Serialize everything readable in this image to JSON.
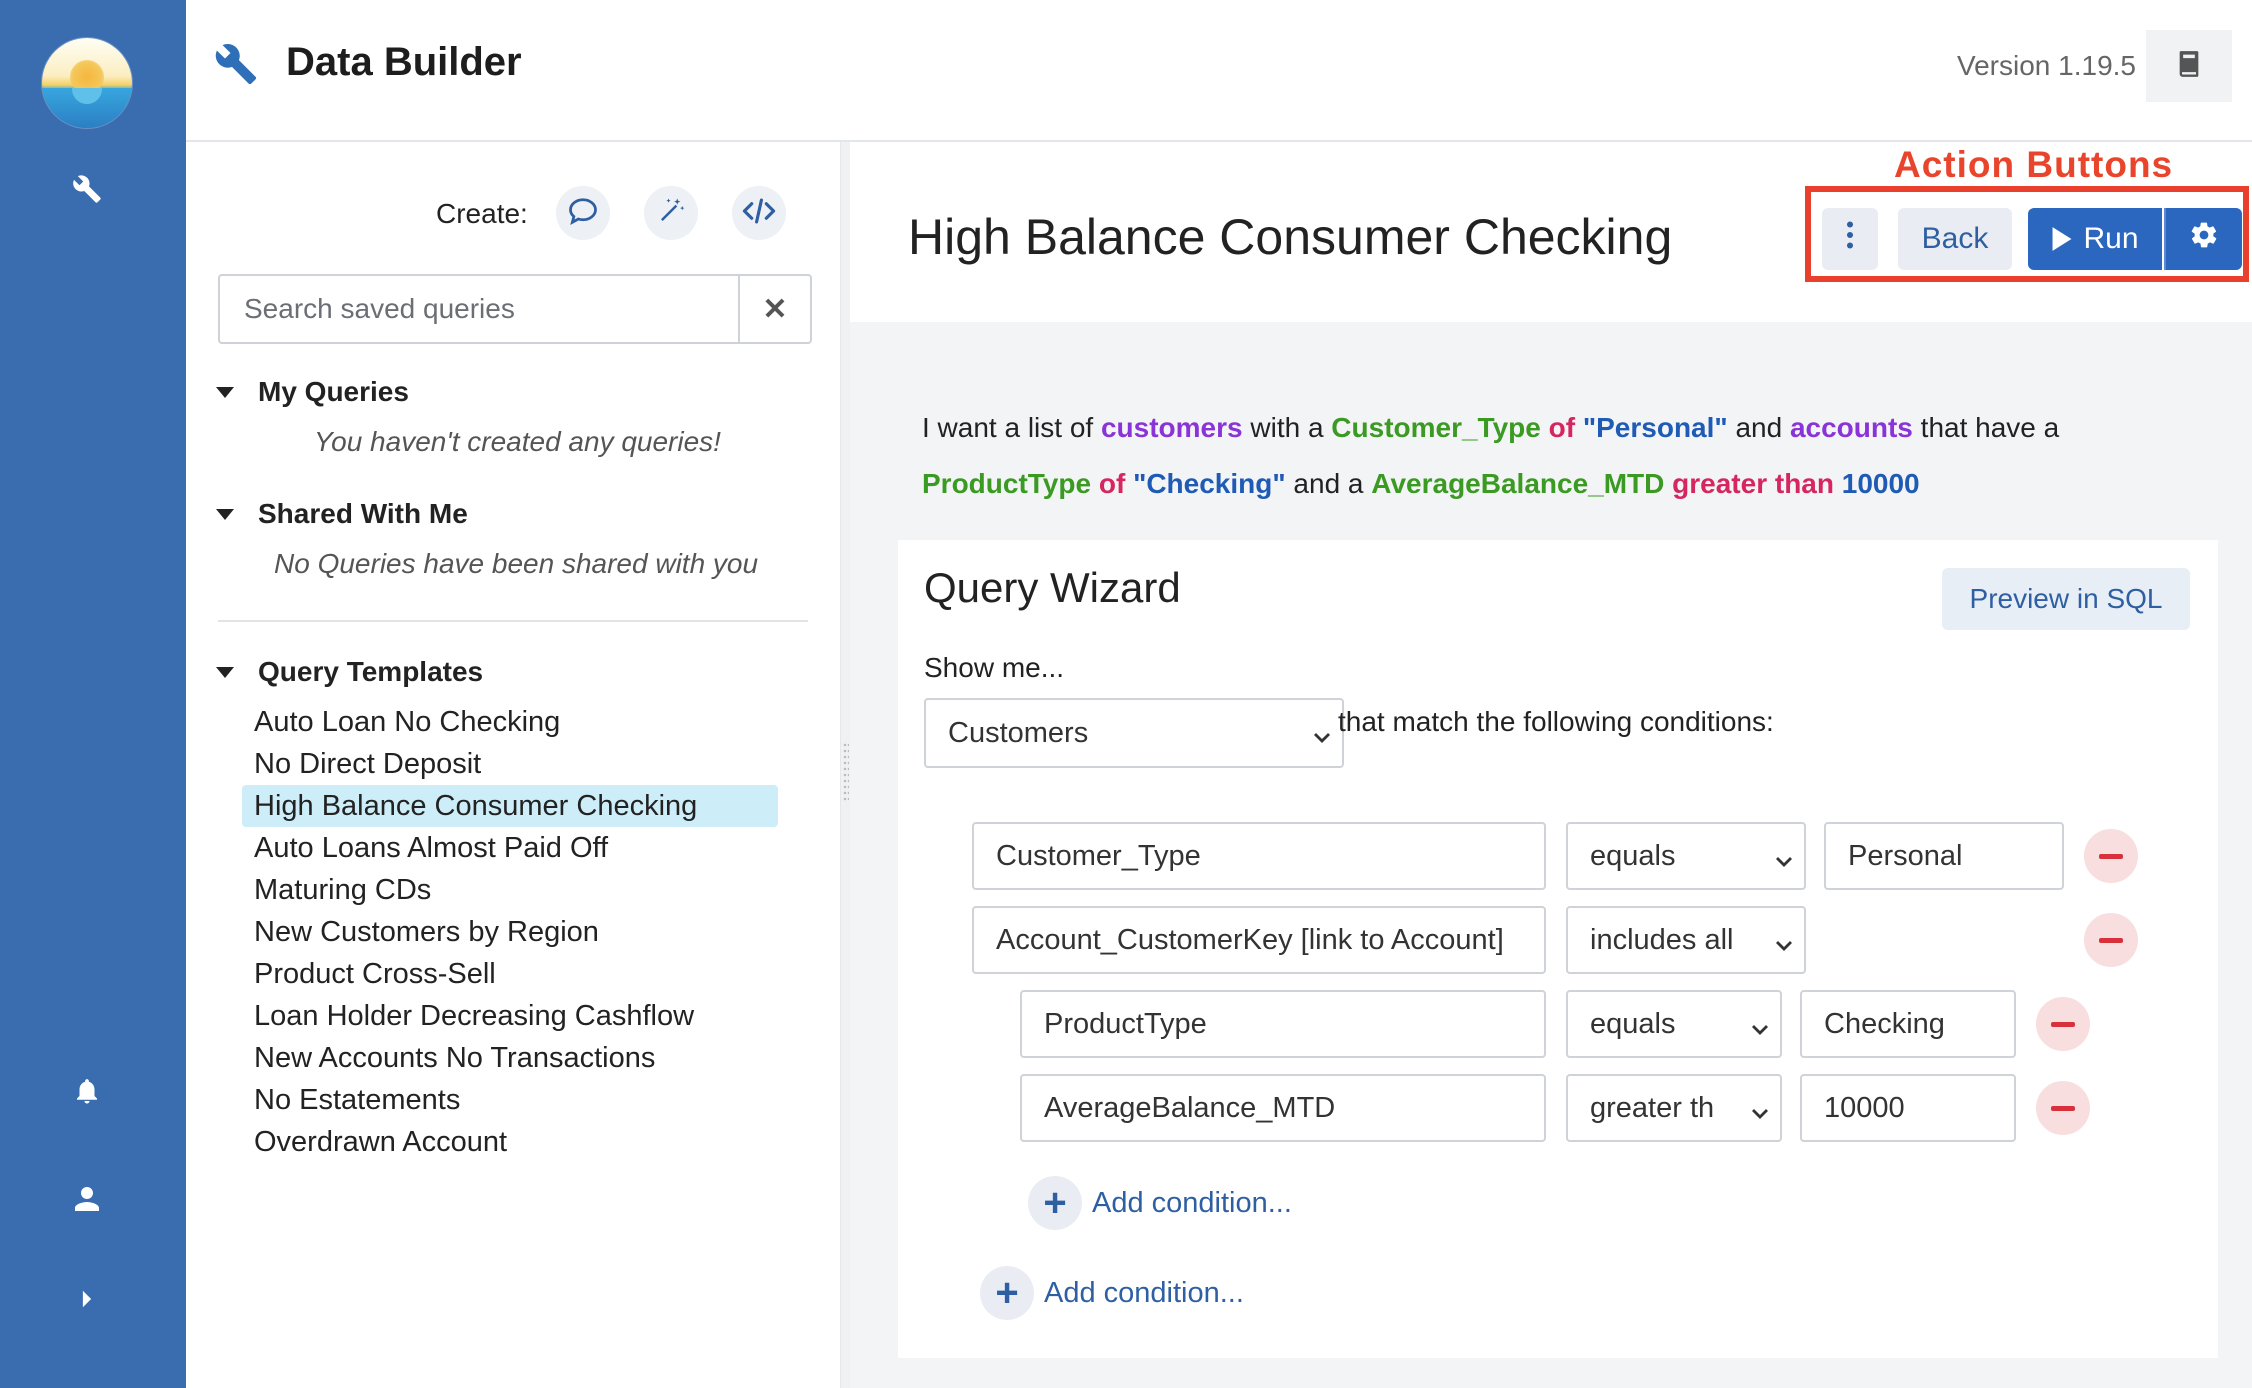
{
  "app": {
    "title": "Data Builder",
    "version": "Version 1.19.5"
  },
  "rail": {
    "icons": [
      "logo",
      "wrench-icon",
      "bell-icon",
      "user-icon",
      "caret-right-icon"
    ]
  },
  "sidebar": {
    "create_label": "Create:",
    "create_buttons": [
      "chat-bubble-icon",
      "magic-wand-icon",
      "code-icon"
    ],
    "search": {
      "placeholder": "Search saved queries",
      "value": ""
    },
    "my_queries": {
      "title": "My Queries",
      "empty": "You haven't created any queries!"
    },
    "shared": {
      "title": "Shared With Me",
      "empty": "No Queries have been shared with you"
    },
    "templates": {
      "title": "Query Templates",
      "active_index": 2,
      "items": [
        "Auto Loan No Checking",
        "No Direct Deposit",
        "High Balance Consumer Checking",
        "Auto Loans Almost Paid Off",
        "Maturing CDs",
        "New Customers by Region",
        "Product Cross-Sell",
        "Loan Holder Decreasing Cashflow",
        "New Accounts No Transactions",
        "No Estatements",
        "Overdrawn Account"
      ]
    }
  },
  "main": {
    "query_title": "High Balance Consumer Checking",
    "annotation": "Action Buttons",
    "actions": {
      "back": "Back",
      "run": "Run"
    },
    "sentence": {
      "p1": "I want a list of ",
      "customers": "customers",
      "p2": " with a ",
      "customer_type": "Customer_Type",
      "of1": " of ",
      "personal": "\"Personal\"",
      "p3": " and ",
      "accounts": "accounts",
      "p4": " that have a",
      "product_type": "ProductType",
      "of2": " of ",
      "checking": "\"Checking\"",
      "p5": " and a ",
      "avg_balance": "AverageBalance_MTD",
      "greater": " greater than ",
      "amount": "10000"
    },
    "wizard": {
      "title": "Query Wizard",
      "preview_sql": "Preview in SQL",
      "show_me": "Show me...",
      "entity": "Customers",
      "match_text": "that match the following conditions:",
      "conditions": [
        {
          "field": "Customer_Type",
          "operator": "equals",
          "value": "Personal"
        },
        {
          "field": "Account_CustomerKey [link to Account]",
          "operator": "includes all"
        },
        {
          "field": "ProductType",
          "operator": "equals",
          "value": "Checking"
        },
        {
          "field": "AverageBalance_MTD",
          "operator": "greater th",
          "value": "10000"
        }
      ],
      "add_condition": "Add condition..."
    }
  },
  "colors": {
    "rail": "#3a6db0",
    "primary": "#2b66bf",
    "annotation": "#e8402c",
    "highlight": "#cdeef9"
  }
}
